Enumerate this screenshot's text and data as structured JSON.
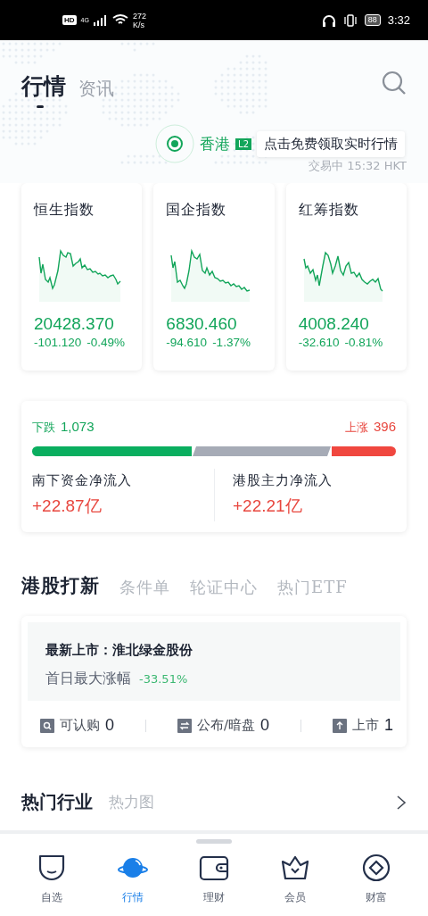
{
  "status_bar": {
    "hd": "HD",
    "network": "4G",
    "speed_value": "272",
    "speed_unit": "K/s",
    "battery": "88",
    "time": "3:32"
  },
  "header": {
    "tabs": [
      {
        "label": "行情",
        "selected": true
      },
      {
        "label": "资讯",
        "selected": false
      }
    ]
  },
  "market": {
    "name": "香港",
    "badge": "L2",
    "promo": "点击免费领取实时行情",
    "status": "交易中 15:32 HKT"
  },
  "indices": [
    {
      "name": "恒生指数",
      "value": "20428.370",
      "change": "-101.120",
      "change_pct": "-0.49%"
    },
    {
      "name": "国企指数",
      "value": "6830.460",
      "change": "-94.610",
      "change_pct": "-1.37%"
    },
    {
      "name": "红筹指数",
      "value": "4008.240",
      "change": "-32.610",
      "change_pct": "-0.81%"
    }
  ],
  "breadth": {
    "fall_label": "下跌",
    "fall_count": "1,073",
    "rise_label": "上涨",
    "rise_count": "396",
    "segments": [
      {
        "kind": "fall"
      },
      {
        "kind": "flat"
      },
      {
        "kind": "rise"
      }
    ],
    "flows": [
      {
        "label": "南下资金净流入",
        "value": "+22.87亿"
      },
      {
        "label": "港股主力净流入",
        "value": "+22.21亿"
      }
    ]
  },
  "ipo_section": {
    "tabs": [
      {
        "label": "港股打新",
        "selected": true
      },
      {
        "label": "条件单",
        "selected": false
      },
      {
        "label": "轮证中心",
        "selected": false
      },
      {
        "label": "热门ETF",
        "selected": false
      }
    ],
    "latest": {
      "title": "最新上市：淮北绿金股份",
      "metric_label": "首日最大涨幅",
      "metric_value": "-33.51%"
    },
    "stats": [
      {
        "kind": "subscribe",
        "label": "可认购",
        "count": "0"
      },
      {
        "kind": "announce",
        "label": "公布/暗盘",
        "count": "0"
      },
      {
        "kind": "listed",
        "label": "上市",
        "count": "1"
      }
    ]
  },
  "industry": {
    "title": "热门行业",
    "subtitle": "热力图"
  },
  "bottom_nav": [
    {
      "kind": "watchlist",
      "label": "自选",
      "selected": false
    },
    {
      "kind": "market",
      "label": "行情",
      "selected": true
    },
    {
      "kind": "finance",
      "label": "理财",
      "selected": false
    },
    {
      "kind": "member",
      "label": "会员",
      "selected": false
    },
    {
      "kind": "wealth",
      "label": "财富",
      "selected": false
    }
  ]
}
